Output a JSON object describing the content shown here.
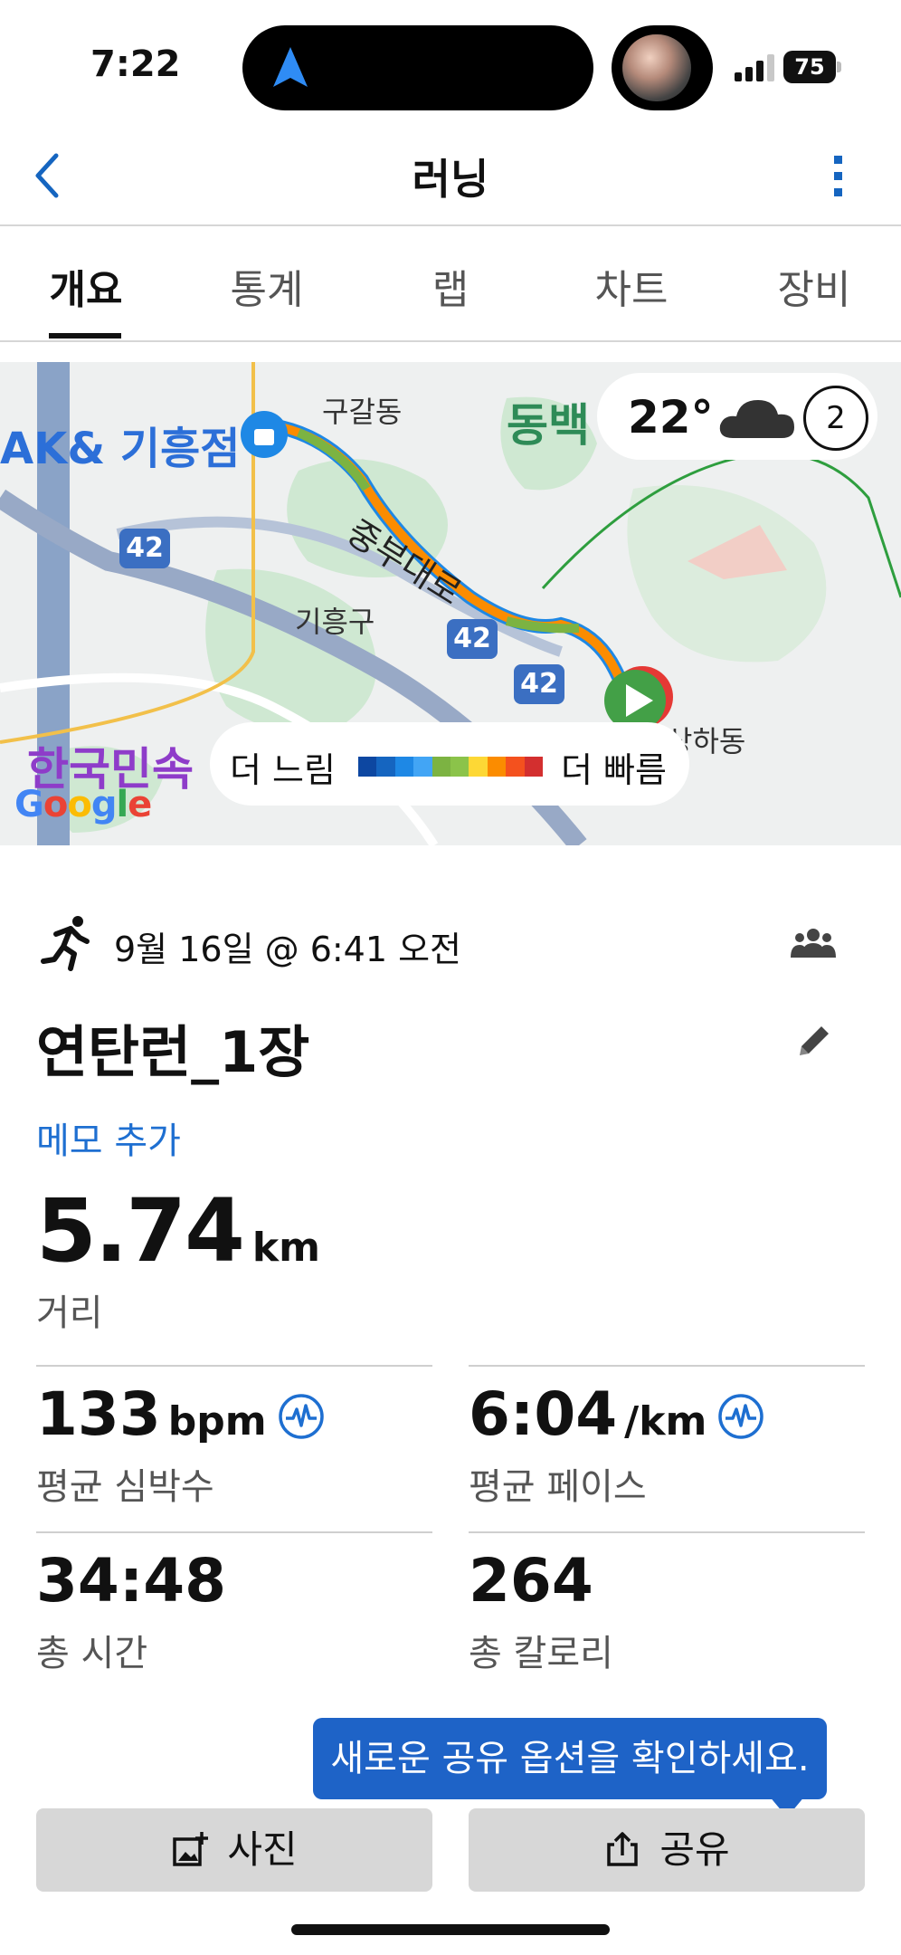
{
  "status_bar": {
    "time": "7:22",
    "battery": "75"
  },
  "header": {
    "title": "러닝"
  },
  "tabs": [
    {
      "label": "개요",
      "active": true
    },
    {
      "label": "통계",
      "active": false
    },
    {
      "label": "랩",
      "active": false
    },
    {
      "label": "차트",
      "active": false
    },
    {
      "label": "장비",
      "active": false
    }
  ],
  "map": {
    "place_labels": [
      "AK& 기흥점",
      "구갈동",
      "동백",
      "중부대로",
      "기흥구",
      "상하동",
      "한국민속"
    ],
    "road_badges": [
      "42",
      "42",
      "42"
    ],
    "weather": {
      "temperature": "22°",
      "icon": "cloud-icon",
      "wind_level": "2"
    },
    "legend": {
      "slow_label": "더 느림",
      "fast_label": "더 빠름",
      "colors": [
        "#0d47a1",
        "#1565c0",
        "#1e88e5",
        "#42a5f5",
        "#7cb342",
        "#8bc34a",
        "#fdd835",
        "#fb8c00",
        "#f4511e",
        "#d32f2f"
      ]
    },
    "attribution": "Google"
  },
  "activity": {
    "date_time": "9월 16일 @ 6:41 오전",
    "name": "연탄런_1장",
    "add_memo": "메모 추가",
    "distance": {
      "value": "5.74",
      "unit": "km",
      "label": "거리"
    }
  },
  "stats": [
    {
      "value": "133",
      "unit": "bpm",
      "label": "평균 심박수",
      "has_hr_icon": true
    },
    {
      "value": "6:04",
      "unit": "/km",
      "label": "평균 페이스",
      "has_hr_icon": true
    },
    {
      "value": "34:48",
      "unit": "",
      "label": "총 시간",
      "has_hr_icon": false
    },
    {
      "value": "264",
      "unit": "",
      "label": "총 칼로리",
      "has_hr_icon": false
    }
  ],
  "tooltip": {
    "text": "새로운 공유 옵션을 확인하세요."
  },
  "buttons": {
    "photo": "사진",
    "share": "공유"
  },
  "colors": {
    "accent": "#1e6fd1",
    "tooltip": "#1e63c7",
    "button_bg": "#d7d7d7"
  }
}
